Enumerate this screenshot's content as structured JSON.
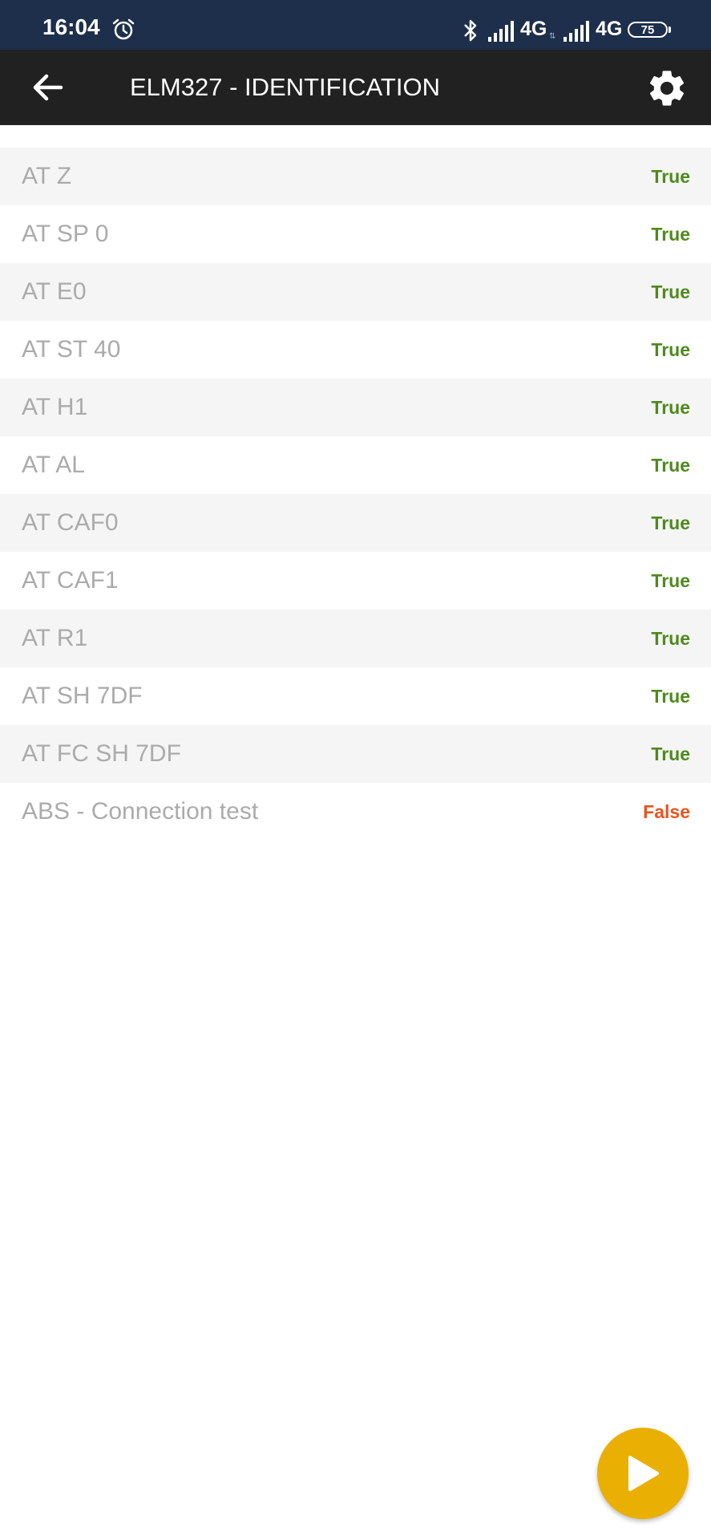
{
  "status_bar": {
    "time": "16:04",
    "network_1": "4G",
    "network_2": "4G",
    "battery_level": "75",
    "icons": [
      "alarm-icon",
      "bluetooth-icon",
      "signal-icon",
      "signal-icon",
      "battery-icon"
    ]
  },
  "app_bar": {
    "title": "ELM327 - IDENTIFICATION",
    "back_icon": "arrow-left-icon",
    "settings_icon": "gear-icon"
  },
  "colors": {
    "status_bar_bg": "#1d2f4a",
    "app_bar_bg": "#212121",
    "true_color": "#4e8a1c",
    "false_color": "#e8541e",
    "fab_color": "#e9b003",
    "label_color": "#ababab"
  },
  "tests": [
    {
      "command": "AT Z",
      "result": "True"
    },
    {
      "command": "AT SP 0",
      "result": "True"
    },
    {
      "command": "AT E0",
      "result": "True"
    },
    {
      "command": "AT ST 40",
      "result": "True"
    },
    {
      "command": "AT H1",
      "result": "True"
    },
    {
      "command": "AT AL",
      "result": "True"
    },
    {
      "command": "AT CAF0",
      "result": "True"
    },
    {
      "command": "AT CAF1",
      "result": "True"
    },
    {
      "command": "AT R1",
      "result": "True"
    },
    {
      "command": "AT SH 7DF",
      "result": "True"
    },
    {
      "command": "AT FC SH 7DF",
      "result": "True"
    },
    {
      "command": "ABS - Connection test",
      "result": "False"
    }
  ],
  "fab": {
    "icon": "play-icon"
  }
}
